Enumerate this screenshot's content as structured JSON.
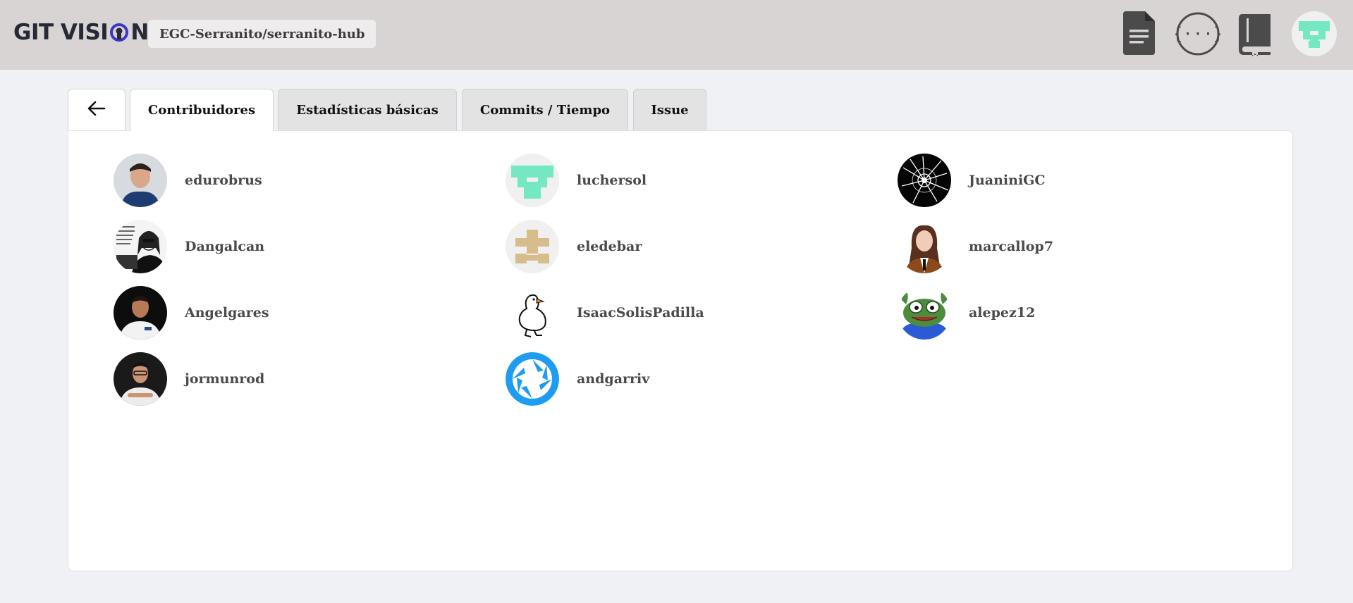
{
  "header": {
    "logo_text_left": "GIT VISI",
    "logo_text_right": "N",
    "repo": "EGC-Serranito/serranito-hub",
    "icons": [
      "document-icon",
      "api-braces-icon",
      "book-icon",
      "user-avatar"
    ]
  },
  "tabs": [
    {
      "label": "←",
      "icon": "arrow-left-icon"
    },
    {
      "label": "Contribuidores",
      "active": true
    },
    {
      "label": "Estadísticas básicas"
    },
    {
      "label": "Commits / Tiempo"
    },
    {
      "label": "Issue"
    }
  ],
  "contributors": [
    {
      "name": "edurobrus",
      "avatar": "photo-person"
    },
    {
      "name": "luchersol",
      "avatar": "identicon-green"
    },
    {
      "name": "JuaniniGC",
      "avatar": "shattered-glass"
    },
    {
      "name": "Dangalcan",
      "avatar": "sketch-person"
    },
    {
      "name": "eledebar",
      "avatar": "identicon-tan"
    },
    {
      "name": "marcallop7",
      "avatar": "photo-person"
    },
    {
      "name": "Angelgares",
      "avatar": "photo-person"
    },
    {
      "name": "IsaacSolisPadilla",
      "avatar": "duck"
    },
    {
      "name": "alepez12",
      "avatar": "frog-cartoon"
    },
    {
      "name": "jormunrod",
      "avatar": "photo-person"
    },
    {
      "name": "andgarriv",
      "avatar": "aperture-logo"
    }
  ],
  "colors": {
    "header_bg": "#d9d4d4",
    "page_bg": "#f0f1f4",
    "identicon_green": "#74e8c2",
    "identicon_tan": "#d8bd8c",
    "aperture_blue": "#1e9cf0"
  }
}
